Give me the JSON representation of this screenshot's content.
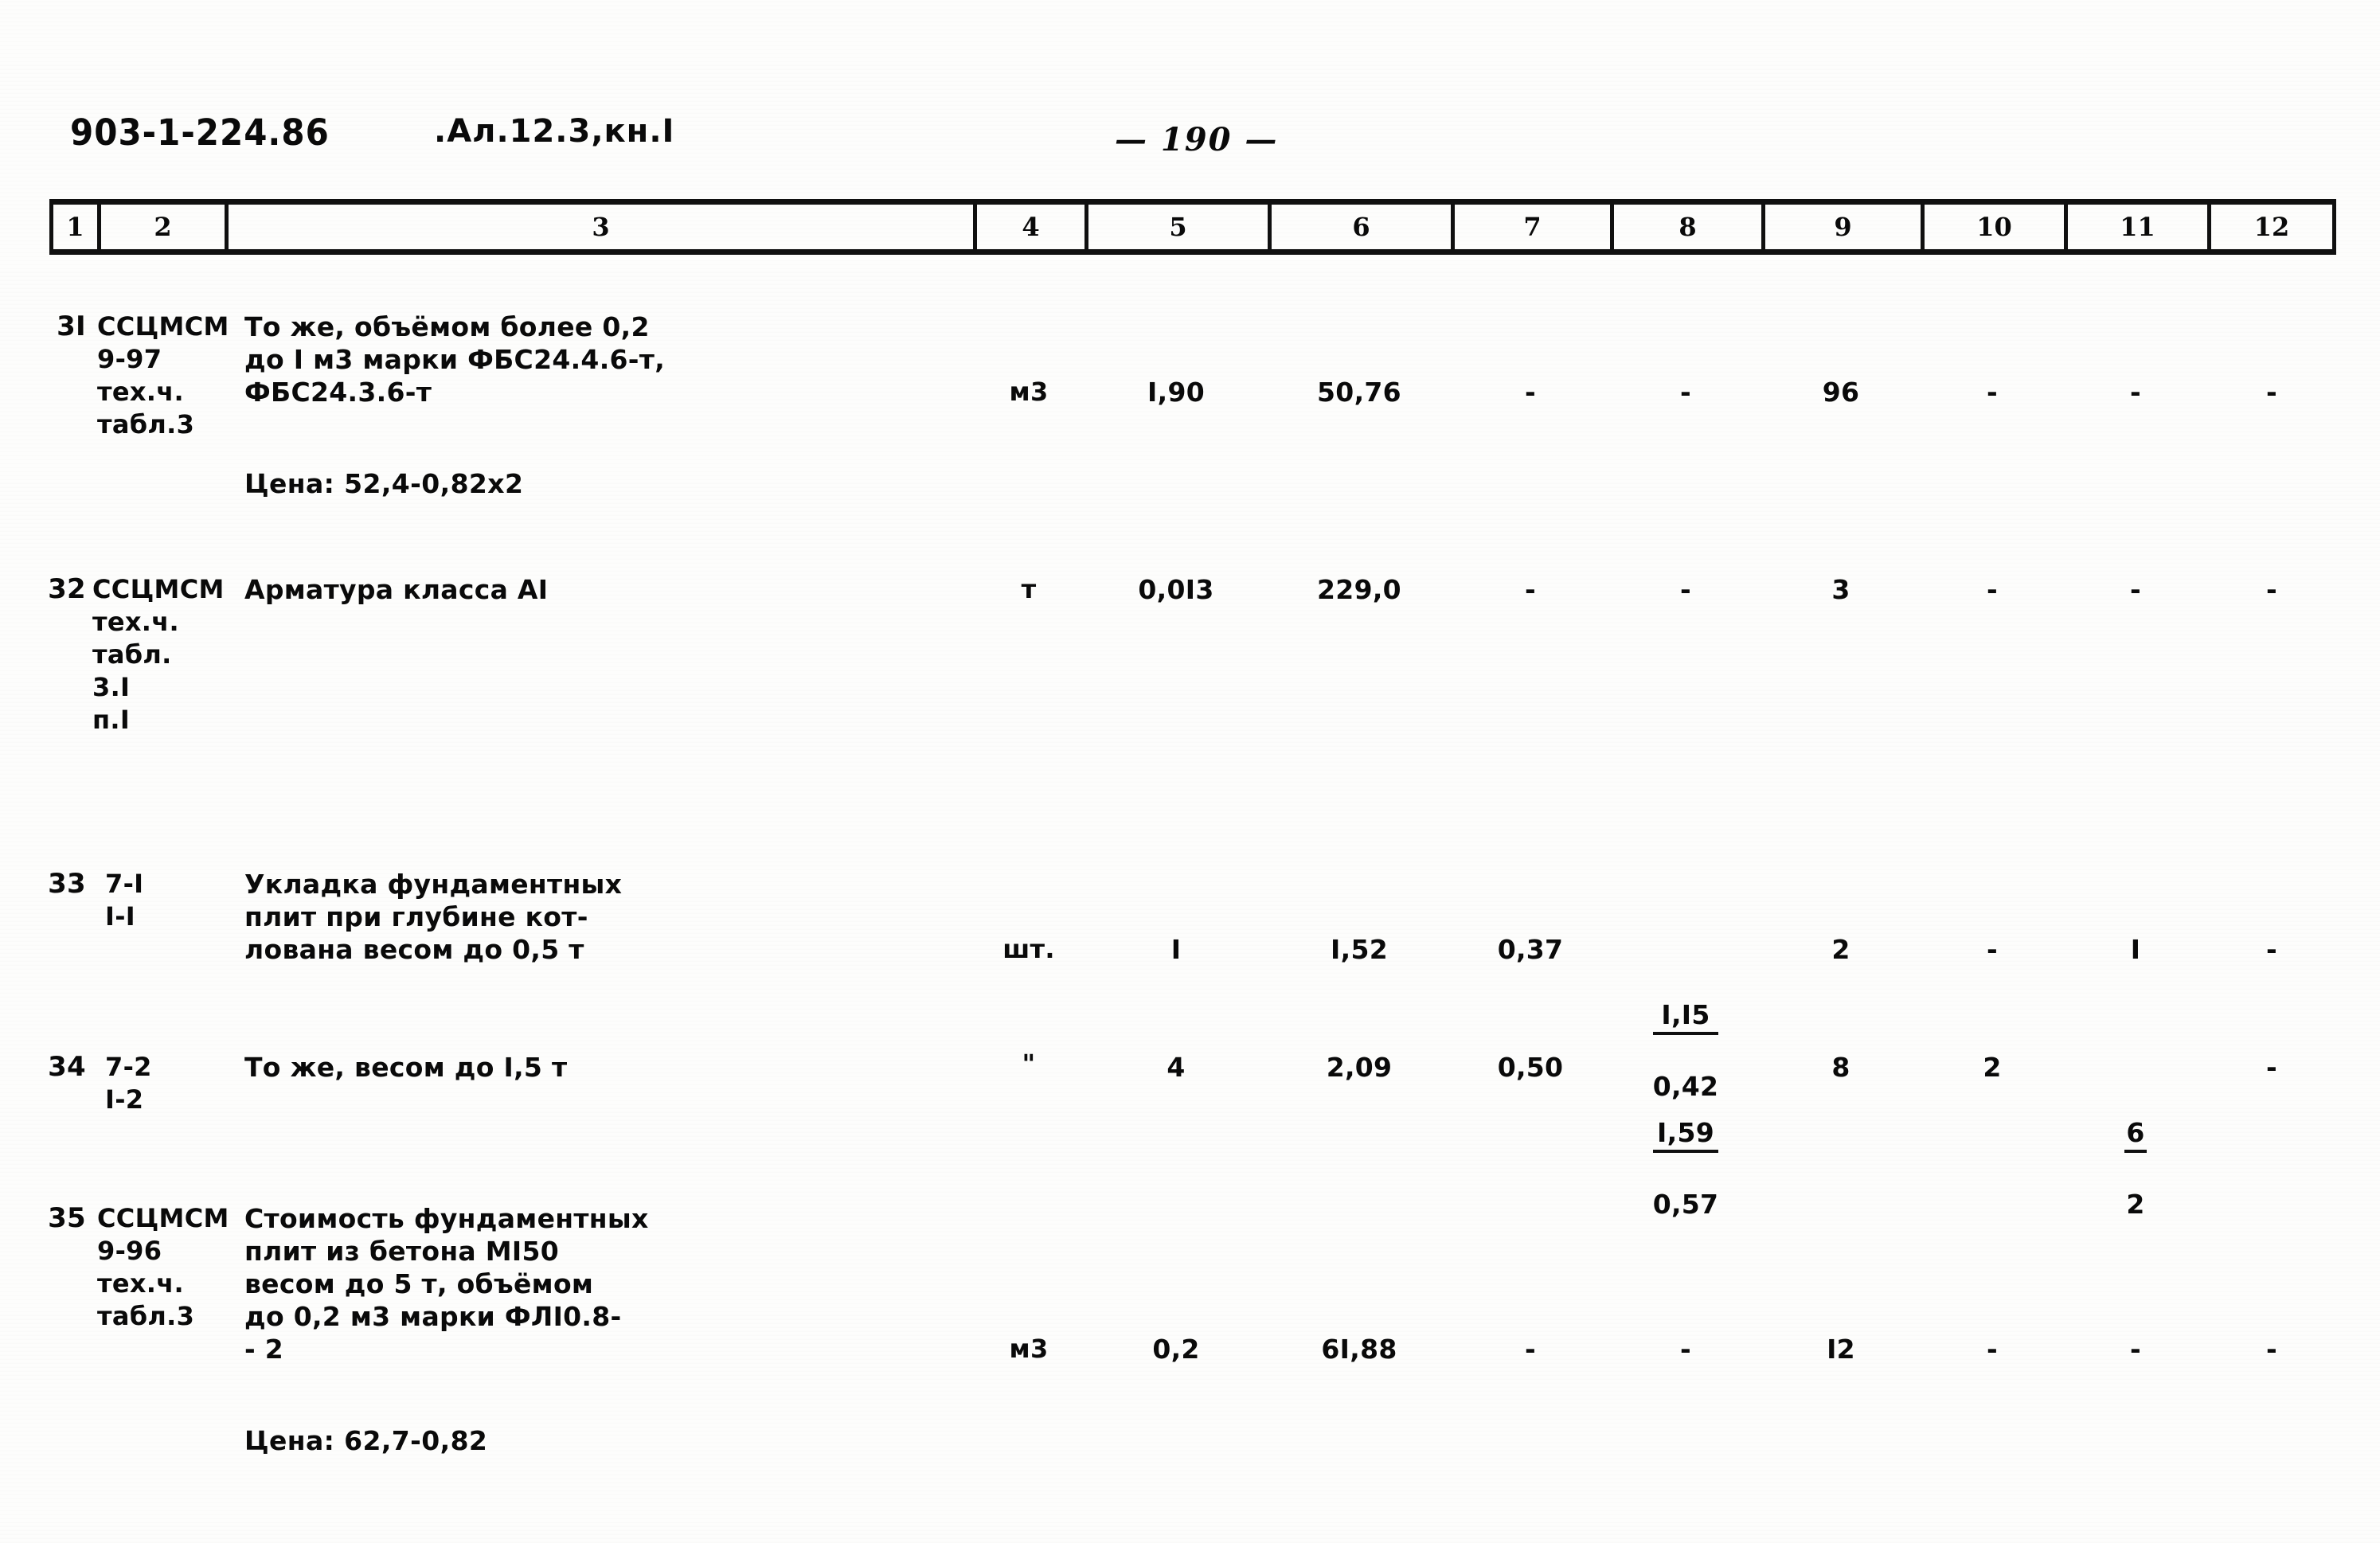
{
  "header": {
    "doc_code": "903-1-224.86",
    "album": ".Ал.12.3,кн.I",
    "page_number": "— 190 —"
  },
  "table": {
    "column_numbers": [
      "1",
      "2",
      "3",
      "4",
      "5",
      "6",
      "7",
      "8",
      "9",
      "10",
      "11",
      "12"
    ],
    "rows": [
      {
        "index": "3I",
        "code": "ССЦМСМ\n9-97\nтех.ч.\nтабл.3",
        "description": "То же, объёмом более 0,2\nдо I м3 марки ФБС24.4.6-т,\nФБС24.3.6-т",
        "unit": "м3",
        "c5": "I,90",
        "c6": "50,76",
        "c7": "-",
        "c8": "-",
        "c9": "96",
        "c10": "-",
        "c11": "-",
        "c12": "-",
        "price_note": "Цена: 52,4-0,82x2"
      },
      {
        "index": "32",
        "code": "ССЦМСМ\nтех.ч.\nтабл.\n3.I\nп.I",
        "description": "Арматура класса AI",
        "unit": "т",
        "c5": "0,0I3",
        "c6": "229,0",
        "c7": "-",
        "c8": "-",
        "c9": "3",
        "c10": "-",
        "c11": "-",
        "c12": "-",
        "price_note": ""
      },
      {
        "index": "33",
        "code": "7-I\nI-I",
        "description": "Укладка фундаментных\nплит при глубине кот-\nлована весом до 0,5 т",
        "unit": "шт.",
        "c5": "I",
        "c6": "I,52",
        "c7": "0,37",
        "c8_top": "I,I5",
        "c8_bot": "0,42",
        "c9": "2",
        "c10": "-",
        "c11": "I",
        "c12": "-",
        "price_note": ""
      },
      {
        "index": "34",
        "code": "7-2\nI-2",
        "description": "То же, весом до I,5 т",
        "unit": "\"",
        "c5": "4",
        "c6": "2,09",
        "c7": "0,50",
        "c8_top": "I,59",
        "c8_bot": "0,57",
        "c9": "8",
        "c10": "2",
        "c11_top": "6",
        "c11_bot": "2",
        "c12": "-",
        "price_note": ""
      },
      {
        "index": "35",
        "code": "ССЦМСМ\n9-96\nтех.ч.\nтабл.3",
        "description": "Стоимость фундаментных\nплит из бетона МI50\nвесом до 5 т, объёмом\nдо 0,2 м3 марки ФЛI0.8-\n- 2",
        "unit": "м3",
        "c5": "0,2",
        "c6": "6I,88",
        "c7": "-",
        "c8": "-",
        "c9": "I2",
        "c10": "-",
        "c11": "-",
        "c12": "-",
        "price_note": "Цена: 62,7-0,82"
      }
    ]
  }
}
